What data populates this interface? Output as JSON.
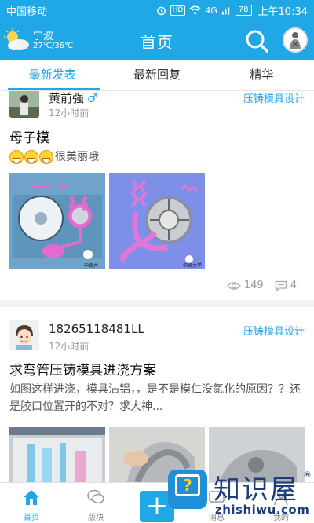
{
  "status_bar": {
    "carrier": "中国移动",
    "hd": "HD",
    "signal": "4G",
    "battery": "78",
    "time": "上午10:34"
  },
  "header": {
    "city": "宁波",
    "temperature": "27℃/36℃",
    "title": "首页",
    "icons": {
      "weather": "partly-cloudy-icon",
      "search": "search-icon",
      "avatar": "user-avatar"
    }
  },
  "tabs": [
    {
      "label": "最新发表",
      "active": true
    },
    {
      "label": "最新回复",
      "active": false
    },
    {
      "label": "精华",
      "active": false
    }
  ],
  "posts": [
    {
      "author": "黄前强",
      "gender_symbol": "♂",
      "time": "12小时前",
      "category": "压铸模具设计",
      "title": "母子模",
      "body": "很美丽哦",
      "views": "149",
      "comments": "4"
    },
    {
      "author": "18265118481LL",
      "time": "12小时前",
      "category": "压铸模具设计",
      "title": "求弯管压铸模具进浇方案",
      "body": "如图这样进浇，模具沾铝，，是不是模仁没氮化的原因？？还是胶口位置开的不对？求大神..."
    }
  ],
  "bottom_nav": [
    {
      "label": "首页",
      "icon": "home-icon",
      "active": true
    },
    {
      "label": "版块",
      "icon": "forum-icon",
      "active": false
    },
    {
      "label": "+",
      "icon": "plus-icon",
      "active": false
    },
    {
      "label": "消息",
      "icon": "message-icon",
      "active": false
    },
    {
      "label": "我的",
      "icon": "profile-icon",
      "active": false
    }
  ],
  "watermark": {
    "name": "知识屋",
    "reg": "®",
    "domain": "zhishiwu.com"
  },
  "colors": {
    "brand": "#20a7e6",
    "category": "#20a7e6"
  }
}
